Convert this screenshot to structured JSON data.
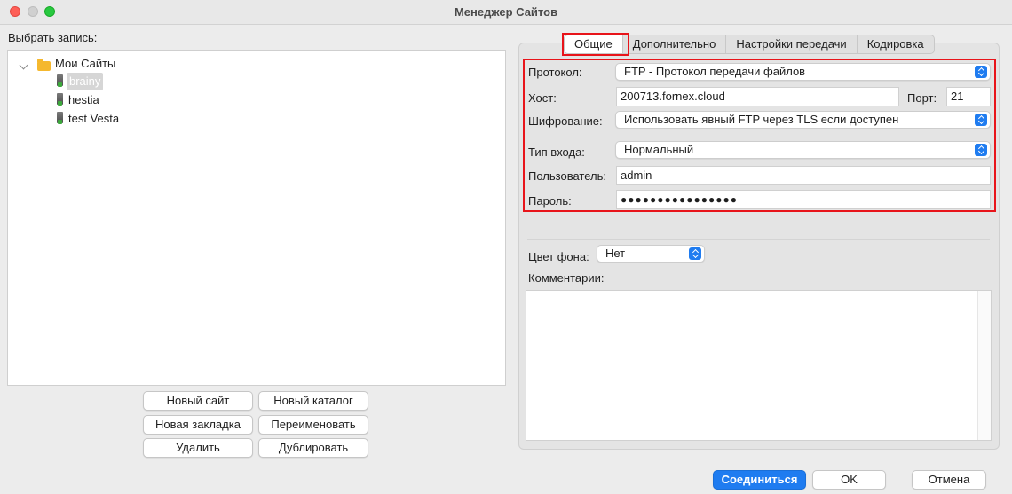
{
  "window": {
    "title": "Менеджер Сайтов"
  },
  "left": {
    "select_entry_label": "Выбрать запись:",
    "tree": {
      "root": "Мои Сайты",
      "sites": [
        "brainy",
        "hestia",
        "test Vesta"
      ]
    },
    "buttons": {
      "new_site": "Новый сайт",
      "new_folder": "Новый каталог",
      "new_bookmark": "Новая закладка",
      "rename": "Переименовать",
      "delete": "Удалить",
      "duplicate": "Дублировать"
    }
  },
  "tabs": [
    "Общие",
    "Дополнительно",
    "Настройки передачи",
    "Кодировка"
  ],
  "form": {
    "protocol_label": "Протокол:",
    "protocol_value": "FTP - Протокол передачи файлов",
    "host_label": "Хост:",
    "host_value": "200713.fornex.cloud",
    "port_label": "Порт:",
    "port_value": "21",
    "encryption_label": "Шифрование:",
    "encryption_value": "Использовать явный FTP через TLS если доступен",
    "logon_type_label": "Тип входа:",
    "logon_type_value": "Нормальный",
    "user_label": "Пользователь:",
    "user_value": "admin",
    "password_label": "Пароль:",
    "password_value": "●●●●●●●●●●●●●●●●",
    "bg_color_label": "Цвет фона:",
    "bg_color_value": "Нет",
    "comments_label": "Комментарии:"
  },
  "footer": {
    "connect": "Соединиться",
    "ok": "OK",
    "cancel": "Отмена"
  },
  "colors": {
    "accent": "#1f7cf0",
    "highlight": "#e8141a"
  }
}
